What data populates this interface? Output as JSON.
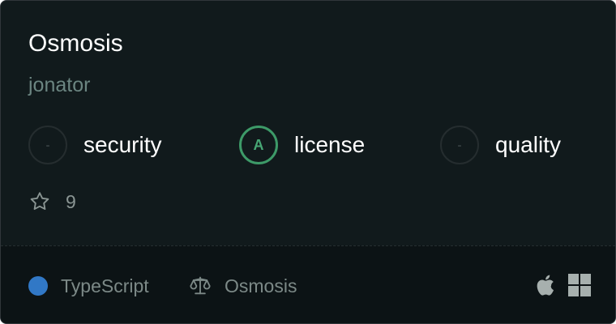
{
  "repo": {
    "name": "Osmosis",
    "owner": "jonator"
  },
  "scores": [
    {
      "label": "security",
      "grade": "-"
    },
    {
      "label": "license",
      "grade": "A"
    },
    {
      "label": "quality",
      "grade": "-"
    }
  ],
  "stars": {
    "count": "9",
    "icon": "star-outline-icon"
  },
  "footer": {
    "language": {
      "name": "TypeScript",
      "color": "#3178c6"
    },
    "license": {
      "name": "Osmosis",
      "icon": "scale-icon"
    },
    "platforms": [
      "apple-icon",
      "windows-icon"
    ]
  },
  "colors": {
    "card_background": "#111a1c",
    "footer_background": "#0c1315",
    "grade_good": "#3d9a68",
    "owner_text": "#6b8581"
  }
}
